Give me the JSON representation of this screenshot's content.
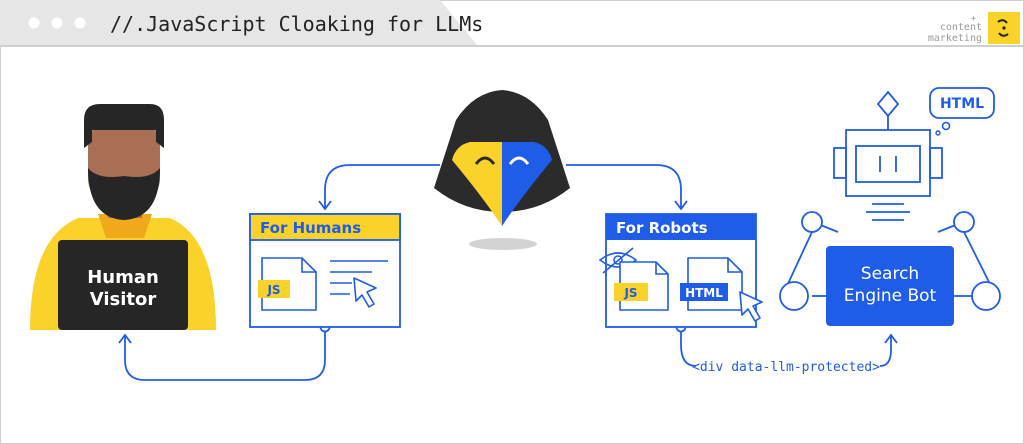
{
  "window": {
    "title": "//.JavaScript Cloaking for LLMs"
  },
  "brand": {
    "line1": "content",
    "line2": "marketing",
    "plus": "+"
  },
  "human": {
    "label_line1": "Human",
    "label_line2": "Visitor"
  },
  "humans_panel": {
    "title": "For Humans",
    "js_tag": "JS"
  },
  "robots_panel": {
    "title": "For Robots",
    "js_tag": "JS",
    "html_tag": "HTML"
  },
  "bot": {
    "label_line1": "Search",
    "label_line2": "Engine Bot",
    "bubble": "HTML"
  },
  "flow": {
    "code_label": "<div data-llm-protected>"
  },
  "colors": {
    "blue": "#1f5ce8",
    "yellow": "#fad22a",
    "dark": "#2b2b2b",
    "chrome": "#e6e6e6",
    "skin": "#a86f55"
  }
}
